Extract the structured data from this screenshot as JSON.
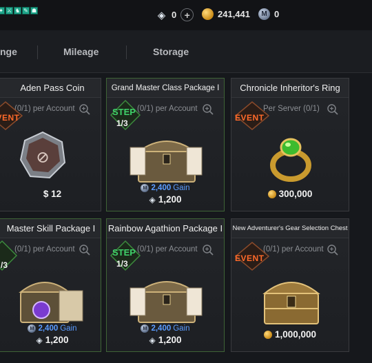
{
  "currency": {
    "diamond": "0",
    "gold": "241,441",
    "m_coin": "0",
    "m_coin_icon_label": "M"
  },
  "tabs": [
    "nge",
    "Mileage",
    "Storage"
  ],
  "cards": [
    {
      "title": "Aden Pass Coin",
      "limit": "(0/1) per Account",
      "badge": "EVENT",
      "price": "$ 12"
    },
    {
      "title": "Grand Master Class Package I",
      "limit": "(0/1) per Account",
      "badge": "STEP",
      "step": "1/3",
      "gain": "2,400",
      "gain_label": "Gain",
      "price": "1,200"
    },
    {
      "title": "Chronicle Inheritor's Ring",
      "limit": "Per Server (0/1)",
      "badge": "EVENT",
      "price": "300,000"
    },
    {
      "title": "Master Skill Package I",
      "limit": "(0/1) per Account",
      "badge": "STEP",
      "step": "/3",
      "gain": "2,400",
      "gain_label": "Gain",
      "price": "1,200"
    },
    {
      "title": "Rainbow Agathion Package I",
      "limit": "(0/1) per Account",
      "badge": "STEP",
      "step": "1/3",
      "gain": "2,400",
      "gain_label": "Gain",
      "price": "1,200"
    },
    {
      "title": "New Adventurer's Gear Selection Chest",
      "limit": "(0/1) per Account",
      "badge": "EVENT",
      "price": "1,000,000"
    }
  ]
}
